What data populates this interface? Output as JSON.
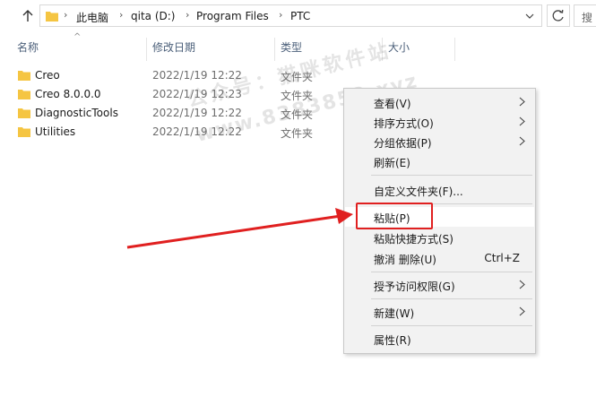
{
  "address_bar": {
    "breadcrumbs": [
      "此电脑",
      "qita (D:)",
      "Program Files",
      "PTC"
    ],
    "search_text": "搜"
  },
  "columns": {
    "name": "名称",
    "date": "修改日期",
    "type": "类型",
    "size": "大小"
  },
  "files": [
    {
      "name": "Creo",
      "date": "2022/1/19 12:22",
      "type": "文件夹"
    },
    {
      "name": "Creo 8.0.0.0",
      "date": "2022/1/19 12:23",
      "type": "文件夹"
    },
    {
      "name": "DiagnosticTools",
      "date": "2022/1/19 12:22",
      "type": "文件夹"
    },
    {
      "name": "Utilities",
      "date": "2022/1/19 12:22",
      "type": "文件夹"
    }
  ],
  "context_menu": {
    "items": [
      {
        "label": "查看(V)",
        "has_submenu": true
      },
      {
        "label": "排序方式(O)",
        "has_submenu": true
      },
      {
        "label": "分组依据(P)",
        "has_submenu": true
      },
      {
        "label": "刷新(E)",
        "has_submenu": false
      },
      {
        "label": "自定义文件夹(F)...",
        "has_submenu": false
      },
      {
        "label": "粘贴(P)",
        "has_submenu": false
      },
      {
        "label": "粘贴快捷方式(S)",
        "has_submenu": false
      },
      {
        "label": "撤消 删除(U)",
        "shortcut": "Ctrl+Z",
        "has_submenu": false
      },
      {
        "label": "授予访问权限(G)",
        "has_submenu": true
      },
      {
        "label": "新建(W)",
        "has_submenu": true
      },
      {
        "label": "属性(R)",
        "has_submenu": false
      }
    ]
  },
  "watermark": {
    "line1": "公众号：猫咪软件站",
    "line2": "www.8383852.xyz"
  },
  "colors": {
    "accent_red": "#e02020",
    "folder_yellow": "#f5c542",
    "header_text": "#4c607a"
  }
}
